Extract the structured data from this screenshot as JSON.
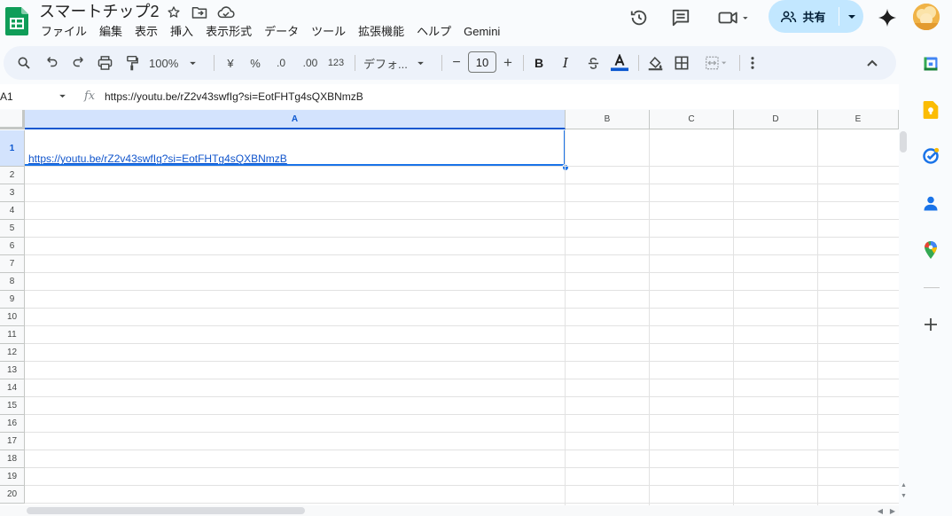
{
  "document": {
    "title": "スマートチップ2"
  },
  "menu": [
    "ファイル",
    "編集",
    "表示",
    "挿入",
    "表示形式",
    "データ",
    "ツール",
    "拡張機能",
    "ヘルプ",
    "Gemini"
  ],
  "header": {
    "share_label": "共有"
  },
  "toolbar": {
    "zoom": "100%",
    "currency": "¥",
    "percent": "%",
    "decimal_decrease": ".0",
    "decimal_increase": ".00",
    "number_format": "123",
    "font": "デフォ...",
    "font_size": "10",
    "minus": "−",
    "plus": "+",
    "bold": "B",
    "italic": "I"
  },
  "formula_bar": {
    "name_box": "A1",
    "fx": "fx",
    "content": "https://youtu.be/rZ2v43swfIg?si=EotFHTg4sQXBNmzB"
  },
  "grid": {
    "columns": [
      "A",
      "B",
      "C",
      "D",
      "E"
    ],
    "rows": [
      "1",
      "2",
      "3",
      "4",
      "5",
      "6",
      "7",
      "8",
      "9",
      "10",
      "11",
      "12",
      "13",
      "14",
      "15",
      "16",
      "17",
      "18",
      "19",
      "20"
    ],
    "a1_value": "https://youtu.be/rZ2v43swfIg?si=EotFHTg4sQXBNmzB"
  },
  "colors": {
    "accent": "#1a73e8",
    "share_bg": "#c2e7ff",
    "sheets_green": "#0f9d58",
    "link": "#1155cc"
  }
}
